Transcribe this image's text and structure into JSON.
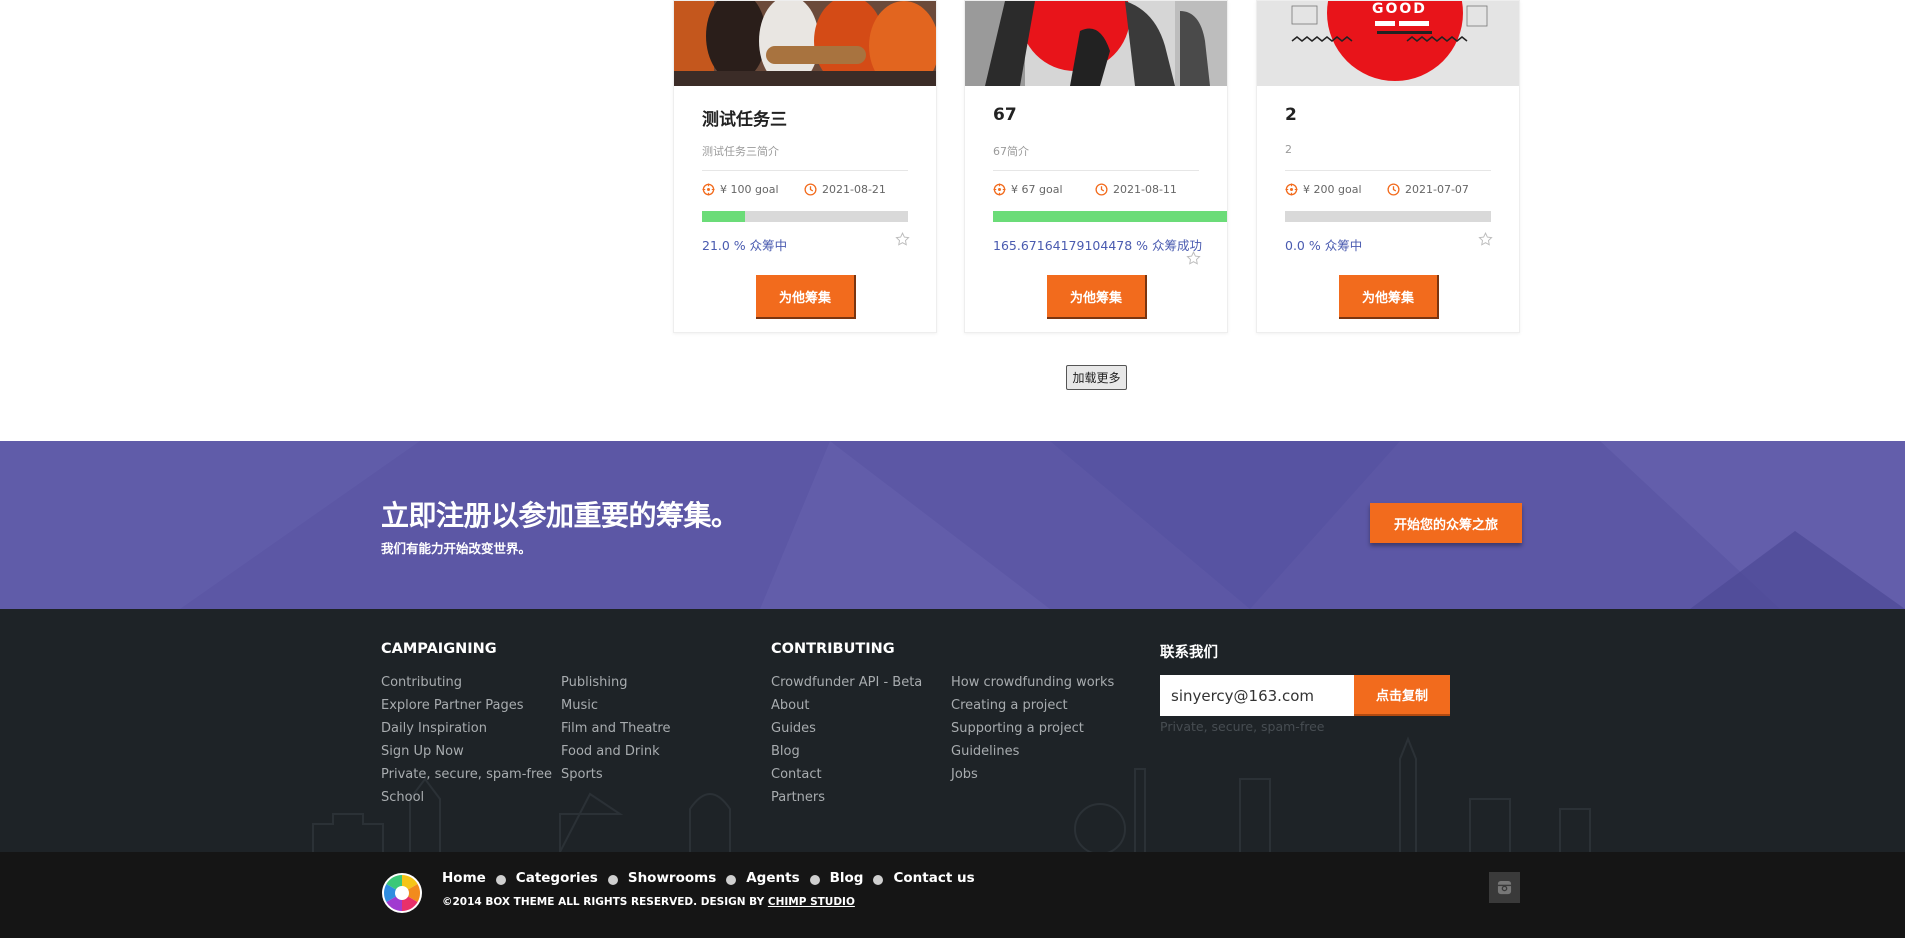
{
  "cards": [
    {
      "title": "测试任务三",
      "description": "测试任务三简介",
      "goal": "¥ 100 goal",
      "date": "2021-08-21",
      "progress_text": "21.0 % 众筹中",
      "progress_fraction": 0.21,
      "button": "为他筹集"
    },
    {
      "title": "67",
      "description": "67简介",
      "goal": "¥ 67 goal",
      "date": "2021-08-11",
      "progress_text": "165.6716417910447​8 % 众筹成功",
      "progress_fraction": 1.0,
      "button": "为他筹集"
    },
    {
      "title": "2",
      "description": "2",
      "goal": "¥ 200 goal",
      "date": "2021-07-07",
      "progress_text": "0.0 % 众筹中",
      "progress_fraction": 0.0,
      "button": "为他筹集"
    }
  ],
  "load_more": "加载更多",
  "promo": {
    "title": "立即注册以参加重要的筹集。",
    "subtitle": "我们有能力开始改变世界。",
    "button": "开始您的众筹之旅"
  },
  "footer": {
    "campaigning": {
      "heading": "CAMPAIGNING",
      "col1": [
        "Contributing",
        "Explore Partner Pages",
        "Daily Inspiration",
        "Sign Up Now",
        "Private, secure, spam-free",
        "School"
      ],
      "col2": [
        "Publishing",
        "Music",
        "Film and Theatre",
        "Food and Drink",
        "Sports"
      ]
    },
    "contributing": {
      "heading": "CONTRIBUTING",
      "col1": [
        "Crowdfunder API - Beta",
        "About",
        "Guides",
        "Blog",
        "Contact",
        "Partners"
      ],
      "col2": [
        "How crowdfunding works",
        "Creating a project",
        "Supporting a project",
        "Guidelines",
        "Jobs"
      ]
    },
    "contact": {
      "heading": "联系我们",
      "email": "sinyercy@163.com",
      "button": "点击复制",
      "note": "Private, secure, spam-free"
    }
  },
  "bottom": {
    "nav": [
      "Home",
      "Categories",
      "Showrooms",
      "Agents",
      "Blog",
      "Contact us"
    ],
    "copyright": "©2014 BOX THEME ALL RIGHTS RESERVED. DESIGN BY",
    "designer": "CHIMP STUDIO",
    "social_icon": "instagram-icon"
  },
  "colors": {
    "accent": "#f26b1d",
    "progress": "#6bdc78",
    "promo_bg": "#5c57a5",
    "footer_bg": "#1e2327",
    "bottom_bg": "#151515",
    "progress_text": "#4a5bb0"
  }
}
